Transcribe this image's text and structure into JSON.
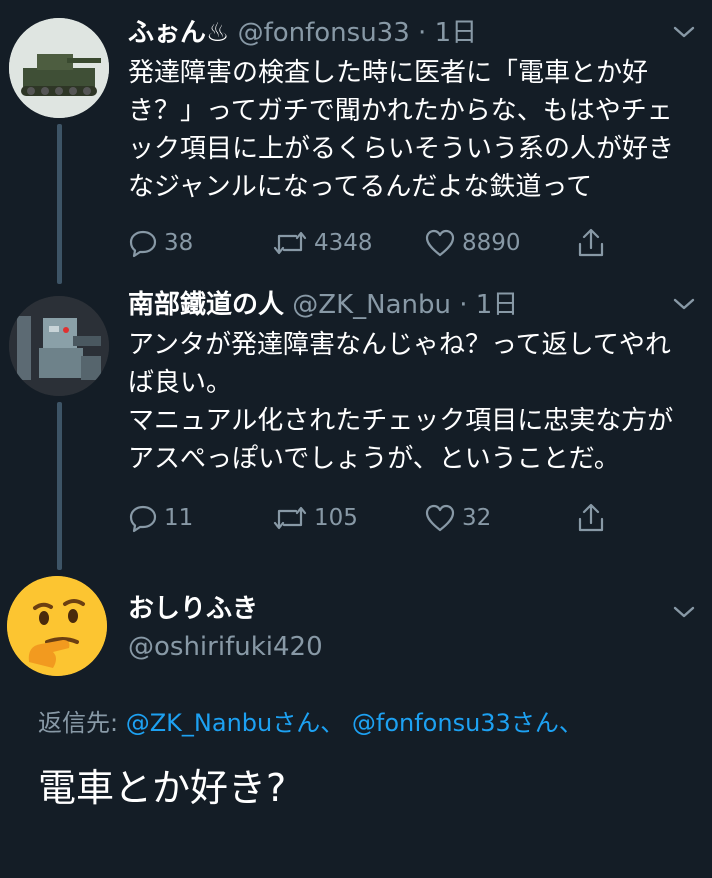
{
  "tweets": [
    {
      "name": "ふぉん♨",
      "handle": "@fonfonsu33",
      "time": "1日",
      "text": "発達障害の検査した時に医者に「電車とか好き？」ってガチで聞かれたからな、もはやチェック項目に上がるくらいそういう系の人が好きなジャンルになってるんだよな鉄道って",
      "replies": "38",
      "retweets": "4348",
      "likes": "8890"
    },
    {
      "name": "南部鐵道の人",
      "handle": "@ZK_Nanbu",
      "time": "1日",
      "text": "アンタが発達障害なんじゃね？って返してやれば良い。\nマニュアル化されたチェック項目に忠実な方がアスぺっぽいでしょうが、ということだ。",
      "replies": "11",
      "retweets": "105",
      "likes": "32"
    }
  ],
  "reply_author": {
    "name": "おしりふき",
    "handle": "@oshirifuki420"
  },
  "replying_to": {
    "label": "返信先:",
    "mention1": "@ZK_Nanbu",
    "suffix1": "さん、",
    "mention2": "@fonfonsu33",
    "suffix2": "さん、"
  },
  "compose_text": "電車とか好き?",
  "icons": {
    "reply": "reply-icon",
    "retweet": "retweet-icon",
    "like": "heart-icon",
    "share": "share-icon",
    "menu": "chevron-down-icon"
  },
  "colors": {
    "background": "#141d26",
    "secondary_text": "#8899a6",
    "link": "#1da1f2"
  }
}
